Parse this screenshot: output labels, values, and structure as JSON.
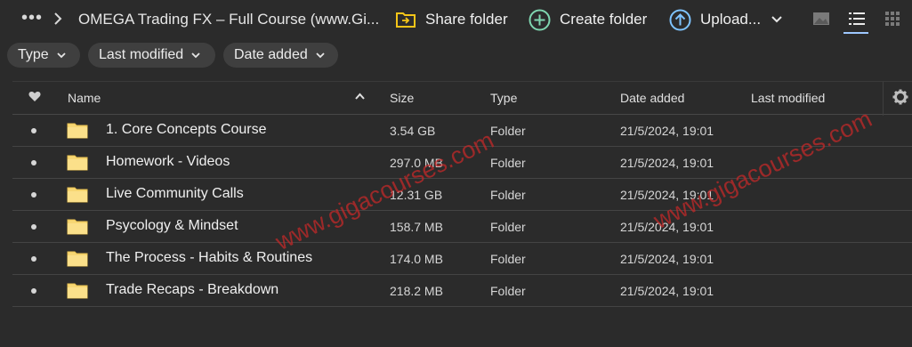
{
  "topbar": {
    "more_label": "•••",
    "breadcrumb": "OMEGA Trading FX – Full Course (www.Gi...",
    "share_label": "Share folder",
    "create_label": "Create folder",
    "upload_label": "Upload...",
    "accent_yellow": "#f5c518",
    "accent_green": "#7fd6b0",
    "accent_blue": "#7fc4ff"
  },
  "filters": {
    "type_label": "Type",
    "last_modified_label": "Last modified",
    "date_added_label": "Date added"
  },
  "table": {
    "headers": {
      "name": "Name",
      "size": "Size",
      "type": "Type",
      "date_added": "Date added",
      "last_modified": "Last modified"
    },
    "rows": [
      {
        "name": "1. Core Concepts Course",
        "size": "3.54 GB",
        "type": "Folder",
        "date_added": "21/5/2024, 19:01"
      },
      {
        "name": "Homework - Videos",
        "size": "297.0 MB",
        "type": "Folder",
        "date_added": "21/5/2024, 19:01"
      },
      {
        "name": "Live Community Calls",
        "size": "12.31 GB",
        "type": "Folder",
        "date_added": "21/5/2024, 19:01"
      },
      {
        "name": "Psycology & Mindset",
        "size": "158.7 MB",
        "type": "Folder",
        "date_added": "21/5/2024, 19:01"
      },
      {
        "name": "The Process - Habits & Routines",
        "size": "174.0 MB",
        "type": "Folder",
        "date_added": "21/5/2024, 19:01"
      },
      {
        "name": "Trade Recaps - Breakdown",
        "size": "218.2 MB",
        "type": "Folder",
        "date_added": "21/5/2024, 19:01"
      }
    ]
  },
  "watermarks": {
    "left": "www.gigacourses.com",
    "right": "www.gigacourses.com"
  }
}
